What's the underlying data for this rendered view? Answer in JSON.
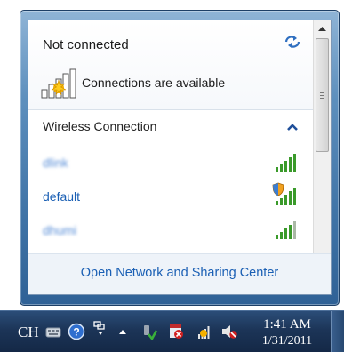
{
  "flyout": {
    "status_title": "Not connected",
    "availability_text": "Connections are available",
    "section_title": "Wireless Connection",
    "networks": [
      {
        "name": "dlink",
        "signal_bars": 4,
        "secured_shield": false,
        "blurred": true
      },
      {
        "name": "default",
        "signal_bars": 4,
        "secured_shield": true,
        "blurred": false
      },
      {
        "name": "dhumi",
        "signal_bars": 4,
        "secured_shield": false,
        "blurred": true
      }
    ],
    "footer_link": "Open Network and Sharing Center",
    "icons": {
      "refresh": "refresh-icon",
      "availability": "network-available-icon",
      "collapse": "chevron-up-icon",
      "signal": "signal-strength-icon",
      "shield": "shield-icon"
    },
    "colors": {
      "link": "#1a5fb4",
      "signal_green": "#3a9a2a",
      "footer_bg": "#eef3f9"
    }
  },
  "taskbar": {
    "language": "CH",
    "time": "1:41 AM",
    "date": "1/31/2011",
    "tray_icons": [
      "keyboard-icon",
      "help-icon",
      "pen-icon",
      "show-hidden-icons-icon",
      "safely-remove-hardware-icon",
      "action-center-icon",
      "network-icon",
      "volume-muted-icon"
    ]
  }
}
